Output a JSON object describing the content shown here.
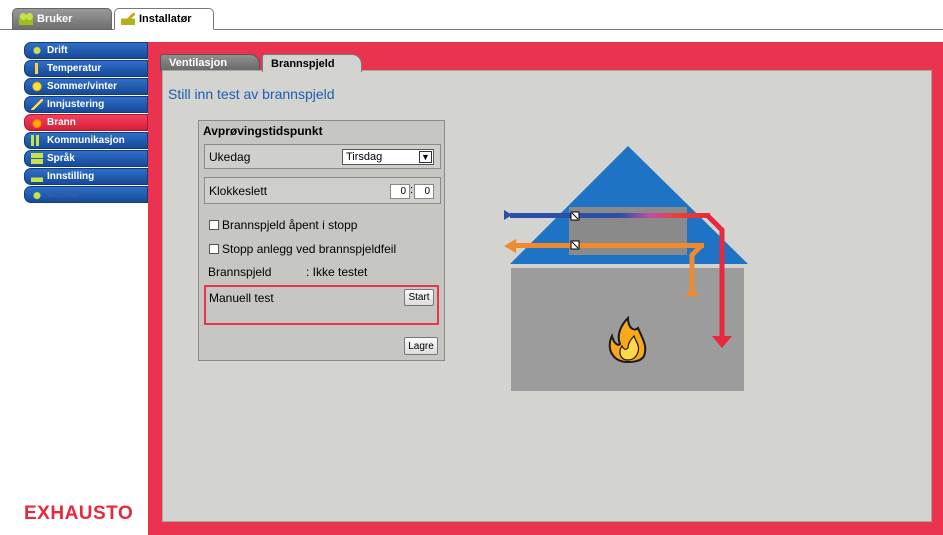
{
  "top_tabs": [
    {
      "label": "Bruker"
    },
    {
      "label": "Installatør"
    }
  ],
  "nav": {
    "items": [
      {
        "label": "Drift",
        "icon": "fan-icon"
      },
      {
        "label": "Temperatur",
        "icon": "thermometer-icon"
      },
      {
        "label": "Sommer/vinter",
        "icon": "sun-icon"
      },
      {
        "label": "Innjustering",
        "icon": "wrench-icon"
      },
      {
        "label": "Brann",
        "icon": "fire-icon",
        "active": true
      },
      {
        "label": "Kommunikasjon",
        "icon": "communication-icon"
      },
      {
        "label": "Språk",
        "icon": "language-icon"
      },
      {
        "label": "Innstilling",
        "icon": "settings-icon"
      },
      {
        "label": "Butikk",
        "icon": "cart-icon",
        "disabled": true
      }
    ]
  },
  "brand": {
    "logo_text": "EXHAUSTO",
    "color": "#e8283c"
  },
  "sub_tabs": [
    {
      "label": "Ventilasjon"
    },
    {
      "label": "Brannspjeld",
      "active": true
    }
  ],
  "page": {
    "heading": "Still inn test av brannspjeld"
  },
  "settings": {
    "section_title": "Avprøvingstidspunkt",
    "weekday_label": "Ukedag",
    "weekday_value": "Tirsdag",
    "time_label": "Klokkeslett",
    "time_hour": "0",
    "time_separator": ":",
    "time_minute": "0",
    "option_open_on_stop": "Brannspjeld åpent i stopp",
    "option_stop_on_error": "Stopp anlegg ved brannspjeldfeil",
    "status_label": "Brannspjeld",
    "status_value": ": Ikke testet",
    "manual_test_label": "Manuell test",
    "start_button": "Start",
    "save_button": "Lagre"
  },
  "colors": {
    "accent_red": "#e9334f",
    "nav_blue": "#1d56a8",
    "panel_grey": "#d3d3cf",
    "roof_blue": "#1e73c4"
  }
}
